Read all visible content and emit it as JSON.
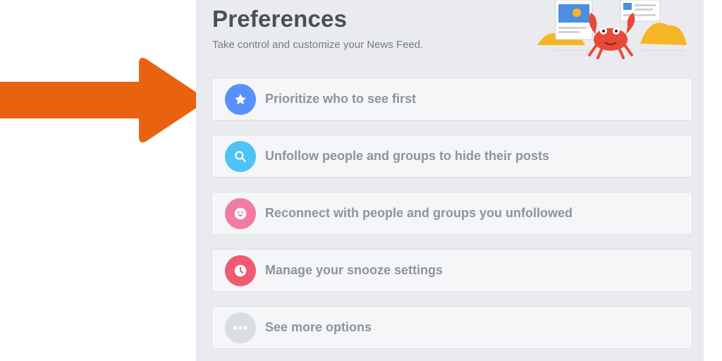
{
  "preferences": {
    "title": "Preferences",
    "subtitle": "Take control and customize your News Feed."
  },
  "options": [
    {
      "label": "Prioritize who to see first",
      "icon": "star-icon",
      "color": "#5890ff"
    },
    {
      "label": "Unfollow people and groups to hide their posts",
      "icon": "search-icon",
      "color": "#4fc3f7"
    },
    {
      "label": "Reconnect with people and groups you unfollowed",
      "icon": "smiley-icon",
      "color": "#f27ba4"
    },
    {
      "label": "Manage your snooze settings",
      "icon": "clock-icon",
      "color": "#f05b73"
    },
    {
      "label": "See more options",
      "icon": "more-dots-icon",
      "color": "#dadde1"
    }
  ],
  "colors": {
    "arrow": "#e8620f",
    "panel_background": "#e9ebee",
    "option_background": "#f5f6f7",
    "label_text": "#8d949e",
    "title_text": "#4b4f56"
  }
}
